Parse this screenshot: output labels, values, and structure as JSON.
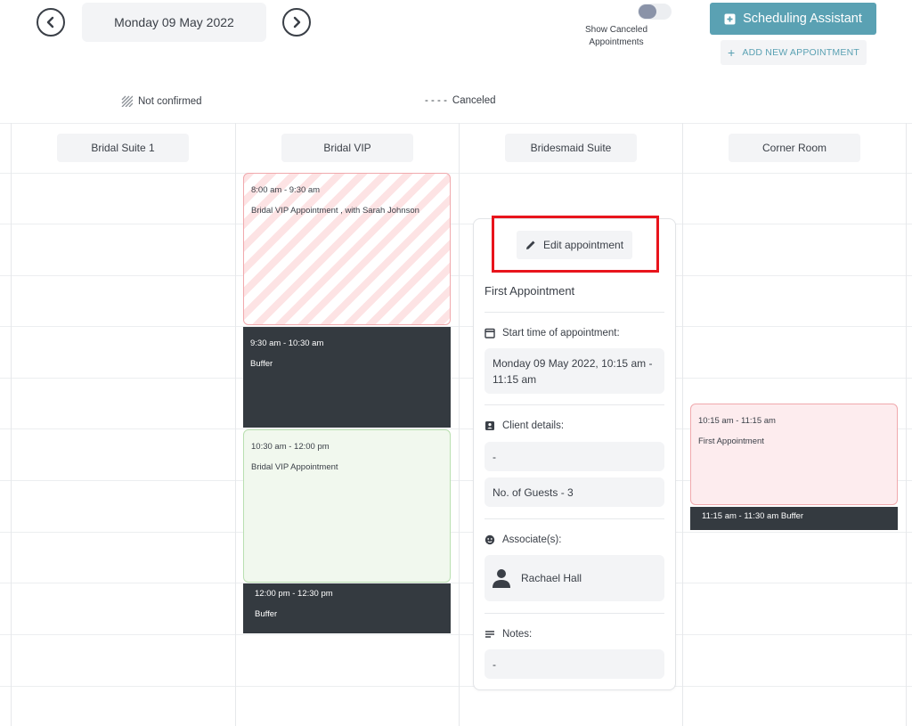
{
  "header": {
    "date": "Monday 09 May 2022",
    "show_canceled_label": "Show Canceled Appointments",
    "scheduling_assistant_label": "Scheduling Assistant",
    "add_new_label": "ADD NEW APPOINTMENT",
    "add_plus": "+"
  },
  "legend": {
    "not_confirmed": "Not confirmed",
    "canceled_dashes": "- - - -",
    "canceled": "Canceled"
  },
  "columns": [
    "Bridal Suite 1",
    "Bridal VIP",
    "Bridesmaid Suite",
    "Corner Room"
  ],
  "appointments": {
    "vip_1": {
      "time": "8:00 am - 9:30 am",
      "title": "Bridal VIP Appointment , with Sarah Johnson"
    },
    "vip_buffer_1": {
      "time": "9:30 am - 10:30 am",
      "title": "Buffer"
    },
    "vip_2": {
      "time": "10:30 am - 12:00 pm",
      "title": "Bridal VIP Appointment"
    },
    "vip_buffer_2": {
      "time": "12:00 pm - 12:30 pm",
      "title": "Buffer"
    },
    "corner_1": {
      "time": "10:15 am - 11:15 am",
      "title": "First Appointment"
    },
    "corner_buffer": {
      "text": "11:15 am - 11:30 am Buffer"
    }
  },
  "popup": {
    "edit_label": "Edit appointment",
    "title": "First Appointment",
    "start_label": "Start time of appointment:",
    "start_value": "Monday 09 May 2022, 10:15 am - 11:15 am",
    "client_label": "Client details:",
    "client_value": "-",
    "guests_value": "No. of Guests - 3",
    "associates_label": "Associate(s):",
    "associate_name": "Rachael Hall",
    "notes_label": "Notes:",
    "notes_value": "-"
  },
  "colors": {
    "accent": "#5aa1b3",
    "buffer": "#343a40",
    "highlight": "#e8141c"
  }
}
